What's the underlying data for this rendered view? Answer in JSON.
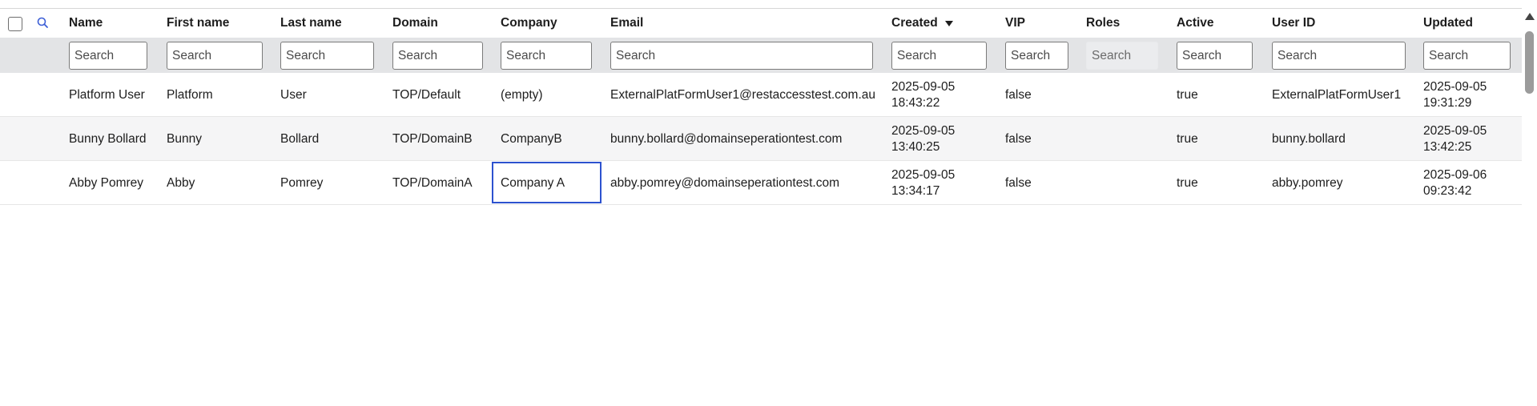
{
  "columns": [
    {
      "key": "name",
      "label": "Name"
    },
    {
      "key": "first_name",
      "label": "First name"
    },
    {
      "key": "last_name",
      "label": "Last name"
    },
    {
      "key": "domain",
      "label": "Domain"
    },
    {
      "key": "company",
      "label": "Company"
    },
    {
      "key": "email",
      "label": "Email"
    },
    {
      "key": "created",
      "label": "Created"
    },
    {
      "key": "vip",
      "label": "VIP"
    },
    {
      "key": "roles",
      "label": "Roles"
    },
    {
      "key": "active",
      "label": "Active"
    },
    {
      "key": "user_id",
      "label": "User ID"
    },
    {
      "key": "updated",
      "label": "Updated"
    }
  ],
  "filter_placeholder": "Search",
  "sort": {
    "column": "created",
    "direction": "descending"
  },
  "rows": [
    {
      "name": "Platform User",
      "first_name": "Platform",
      "last_name": "User",
      "domain": "TOP/Default",
      "company": "(empty)",
      "email": "ExternalPlatFormUser1@restaccesstest.com.au",
      "created": "2025-09-05 18:43:22",
      "vip": "false",
      "roles": "",
      "active": "true",
      "user_id": "ExternalPlatFormUser1",
      "updated": "2025-09-05 19:31:29"
    },
    {
      "name": "Bunny Bollard",
      "first_name": "Bunny",
      "last_name": "Bollard",
      "domain": "TOP/DomainB",
      "company": "CompanyB",
      "email": "bunny.bollard@domainseperationtest.com",
      "created": "2025-09-05 13:40:25",
      "vip": "false",
      "roles": "",
      "active": "true",
      "user_id": "bunny.bollard",
      "updated": "2025-09-05 13:42:25"
    },
    {
      "name": "Abby Pomrey",
      "first_name": "Abby",
      "last_name": "Pomrey",
      "domain": "TOP/DomainA",
      "company": "Company A",
      "email": "abby.pomrey@domainseperationtest.com",
      "created": "2025-09-05 13:34:17",
      "vip": "false",
      "roles": "",
      "active": "true",
      "user_id": "abby.pomrey",
      "updated": "2025-09-06 09:23:42"
    }
  ],
  "colors": {
    "link": "#3357d6",
    "filter_bar": "#e3e4e6",
    "focus_outline": "#2d52cf",
    "row_alt": "#f5f5f6"
  }
}
